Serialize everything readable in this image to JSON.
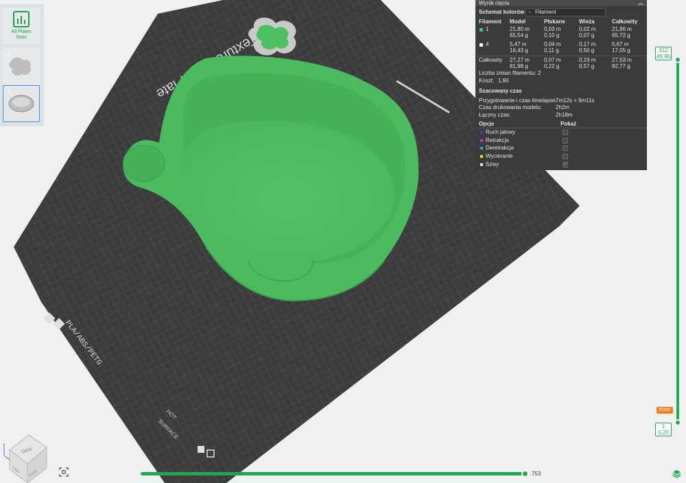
{
  "plates": {
    "stats_label_1": "All Plates",
    "stats_label_2": "Stats",
    "plate1_number": "1",
    "plate2_number": "2"
  },
  "bed": {
    "texture_label": "Textured PEI Plate",
    "material_label": "PLA/ABS/PETG",
    "hot_label": "HOT",
    "surface_label": "SURFACE"
  },
  "view_cube": {
    "face_top": "Góra",
    "face_left": "Lewo",
    "face_front": "Przód"
  },
  "panel": {
    "title": "Wynik cięcia",
    "scheme_label": "Schemat kolorów",
    "scheme_value": "Filament",
    "headers": [
      "Filament",
      "Model",
      "Płukane",
      "Wieża",
      "Całkowity"
    ],
    "rows": [
      {
        "id": "1",
        "color": "#4fc062",
        "model": [
          "21,80 m",
          "65,54 g"
        ],
        "flush": [
          "0,03 m",
          "0,10 g"
        ],
        "tower": [
          "0,02 m",
          "0,07 g"
        ],
        "total": [
          "21,86 m",
          "65,72 g"
        ]
      },
      {
        "id": "4",
        "color": "#ffffff",
        "model": [
          "5,47 m",
          "16,43 g"
        ],
        "flush": [
          "0,04 m",
          "0,11 g"
        ],
        "tower": [
          "0,17 m",
          "0,50 g"
        ],
        "total": [
          "5,67 m",
          "17,05 g"
        ]
      }
    ],
    "total_row": {
      "label": "Całkowity",
      "model": [
        "27,27 m",
        "81,98 g"
      ],
      "flush": [
        "0,07 m",
        "0,22 g"
      ],
      "tower": [
        "0,19 m",
        "0,57 g"
      ],
      "total": [
        "27,53 m",
        "82,77 g"
      ]
    },
    "changes_label": "Liczba zmian filamentu:",
    "changes_value": "2",
    "cost_label": "Koszt:",
    "cost_value": "1,90",
    "time_title": "Szacowany czas",
    "prep_label": "Przygotowanie i czas timelapse:",
    "prep_value": "7m12s + 9m11s",
    "print_label": "Czas drukowania modelu:",
    "print_value": "2h2m",
    "total_time_label": "Łączny czas:",
    "total_time_value": "2h18m",
    "options_header": "Opcje",
    "show_header": "Pokaż",
    "options": [
      {
        "label": "Ruch jałowy",
        "color": "#2f4fb8",
        "shown": false
      },
      {
        "label": "Retrakcja",
        "color": "#c040c8",
        "shown": false
      },
      {
        "label": "Deretrakcja",
        "color": "#3aa0d8",
        "shown": false
      },
      {
        "label": "Wycieranie",
        "color": "#f2e21c",
        "shown": false
      },
      {
        "label": "Szwy",
        "color": "#e8e8e8",
        "shown": true
      }
    ]
  },
  "vertical_slider": {
    "top_layer": "312",
    "top_height": "49,96",
    "bottom_layer": "1",
    "bottom_height": "0,20",
    "color_button": "Kolor"
  },
  "horizontal_slider": {
    "value": "753"
  },
  "colors": {
    "accent": "#1fa84f",
    "model_green": "#4fc062",
    "bed": "#3f3f3f",
    "panel_bg": "#3a3b3d"
  }
}
